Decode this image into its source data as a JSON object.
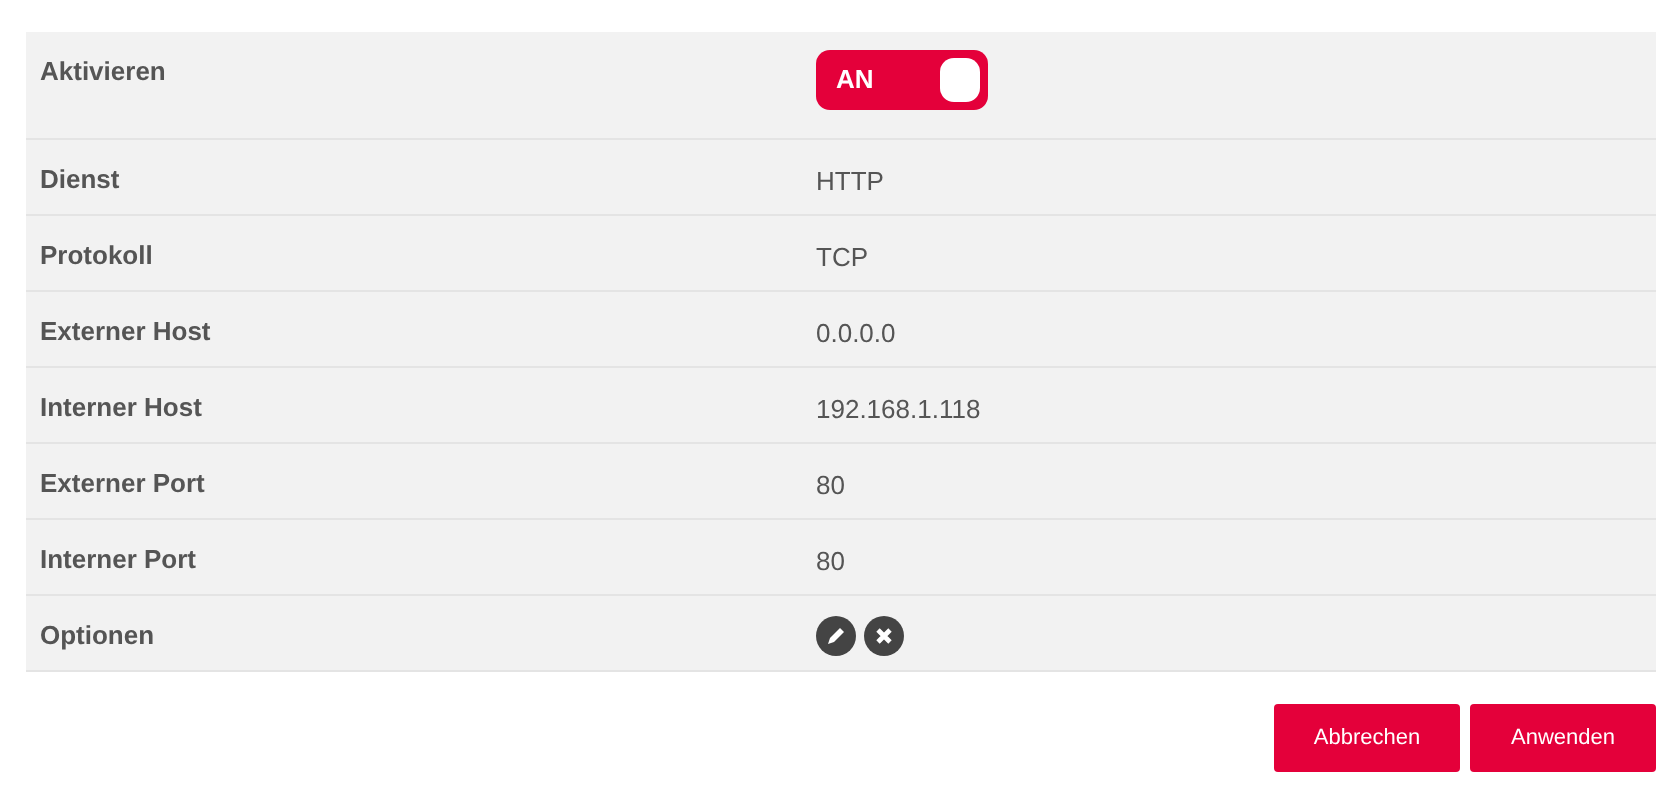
{
  "rows": [
    {
      "kind": "toggle",
      "label": "Aktivieren",
      "toggle": {
        "label": "AN",
        "on": true
      }
    },
    {
      "kind": "text",
      "label": "Dienst",
      "value": "HTTP"
    },
    {
      "kind": "text",
      "label": "Protokoll",
      "value": "TCP"
    },
    {
      "kind": "text",
      "label": "Externer Host",
      "value": "0.0.0.0"
    },
    {
      "kind": "text",
      "label": "Interner Host",
      "value": "192.168.1.118"
    },
    {
      "kind": "text",
      "label": "Externer Port",
      "value": "80"
    },
    {
      "kind": "text",
      "label": "Interner Port",
      "value": "80"
    },
    {
      "kind": "actions",
      "label": "Optionen"
    }
  ],
  "buttons": [
    "Abbrechen",
    "Anwenden"
  ]
}
